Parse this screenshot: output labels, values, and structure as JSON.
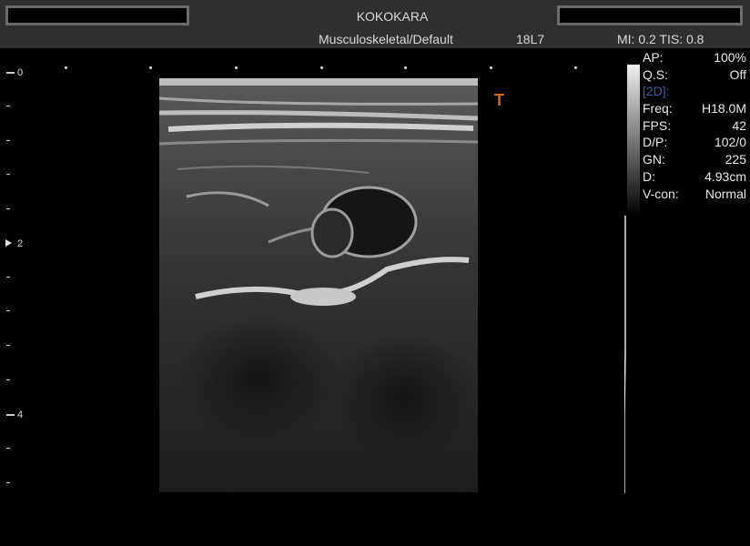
{
  "header": {
    "title": "KOKOKARA",
    "preset": "Musculoskeletal/Default",
    "probe": "18L7",
    "mi_tis": "MI:  0.2  TIS:  0.8"
  },
  "depth_scale": {
    "labels": [
      "0",
      "2",
      "4"
    ]
  },
  "orientation_marker": "T",
  "params": {
    "section_label": "[2D]:",
    "rows": [
      {
        "label": "AP:",
        "value": "100%"
      },
      {
        "label": "Q.S:",
        "value": "Off"
      },
      {
        "label": "Freq:",
        "value": "H18.0M"
      },
      {
        "label": "FPS:",
        "value": "42"
      },
      {
        "label": "D/P:",
        "value": "102/0"
      },
      {
        "label": "GN:",
        "value": "225"
      },
      {
        "label": "D:",
        "value": "4.93cm"
      },
      {
        "label": "V-con:",
        "value": "Normal"
      }
    ]
  },
  "colors": {
    "background": "#000000",
    "header": "#2f2f2f",
    "orientation_marker": "#d0651e",
    "section_label": "#3c5fa0"
  }
}
